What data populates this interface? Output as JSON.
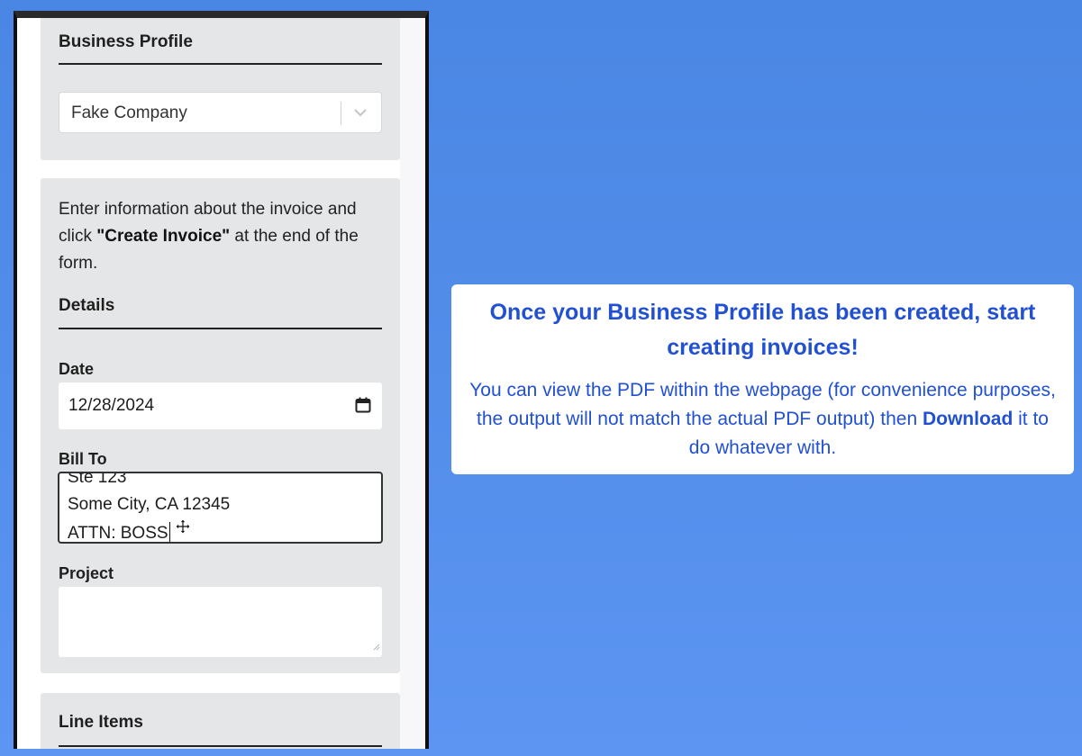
{
  "phone": {
    "profile_section": {
      "title": "Business Profile",
      "selected_company": "Fake Company"
    },
    "invoice_section": {
      "intro_before": "Enter information about the invoice and click ",
      "intro_bold": "\"Create Invoice\"",
      "intro_after": " at the end of the form.",
      "details_title": "Details",
      "date_label": "Date",
      "date_value": "12/28/2024",
      "bill_to_label": "Bill To",
      "bill_to_lines": [
        "Ste 123",
        "Some City, CA 12345",
        "ATTN: BOSS"
      ],
      "project_label": "Project",
      "project_value": ""
    },
    "line_items_section": {
      "title": "Line Items"
    }
  },
  "callout": {
    "title": "Once your Business Profile has been created, start creating invoices!",
    "body_before": "You can view the PDF within the webpage (for convenience purposes, the output will not match the actual PDF output) then ",
    "body_bold": "Download",
    "body_after": " it to do whatever with."
  },
  "colors": {
    "background_top": "#4a86e3",
    "background_bottom": "#5c95f2",
    "callout_text": "#2150d2",
    "card_background": "#e5e6e8"
  },
  "icons": [
    "chevron-down-icon",
    "calendar-icon",
    "move-cursor-icon",
    "resize-grip-icon"
  ]
}
